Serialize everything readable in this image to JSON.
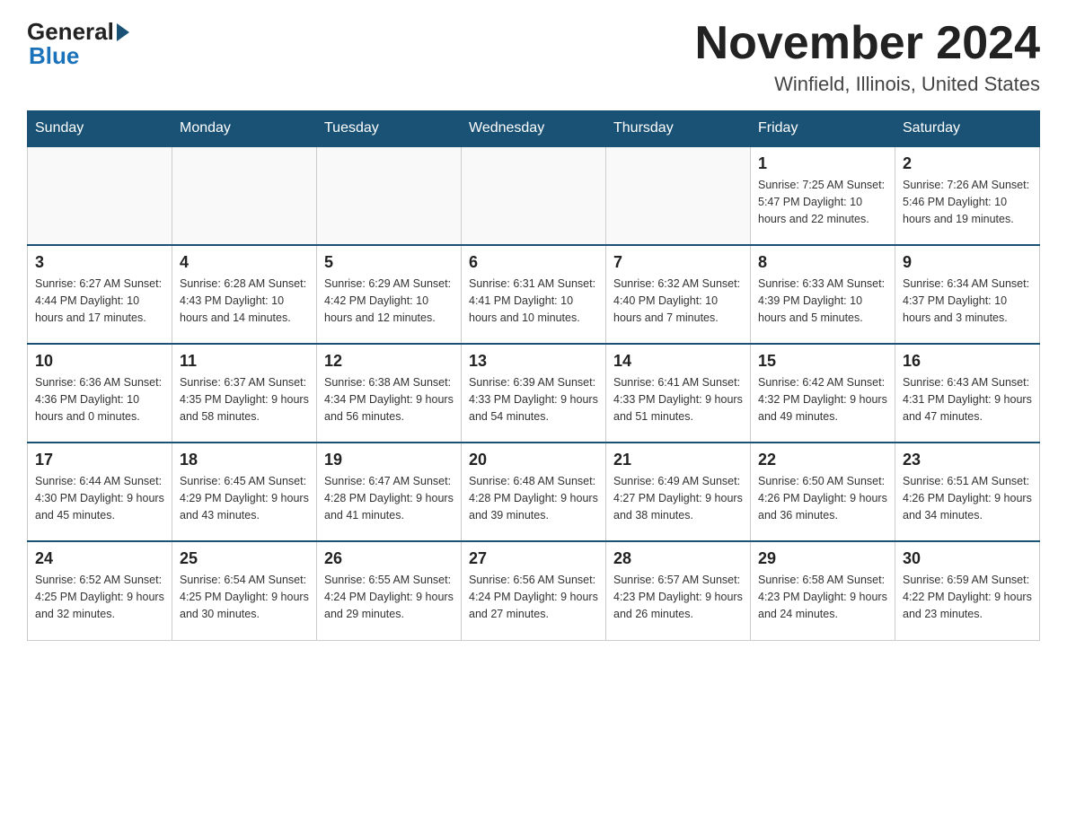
{
  "logo": {
    "general": "General",
    "blue": "Blue"
  },
  "title": "November 2024",
  "subtitle": "Winfield, Illinois, United States",
  "days_of_week": [
    "Sunday",
    "Monday",
    "Tuesday",
    "Wednesday",
    "Thursday",
    "Friday",
    "Saturday"
  ],
  "weeks": [
    [
      {
        "day": "",
        "info": ""
      },
      {
        "day": "",
        "info": ""
      },
      {
        "day": "",
        "info": ""
      },
      {
        "day": "",
        "info": ""
      },
      {
        "day": "",
        "info": ""
      },
      {
        "day": "1",
        "info": "Sunrise: 7:25 AM\nSunset: 5:47 PM\nDaylight: 10 hours and 22 minutes."
      },
      {
        "day": "2",
        "info": "Sunrise: 7:26 AM\nSunset: 5:46 PM\nDaylight: 10 hours and 19 minutes."
      }
    ],
    [
      {
        "day": "3",
        "info": "Sunrise: 6:27 AM\nSunset: 4:44 PM\nDaylight: 10 hours and 17 minutes."
      },
      {
        "day": "4",
        "info": "Sunrise: 6:28 AM\nSunset: 4:43 PM\nDaylight: 10 hours and 14 minutes."
      },
      {
        "day": "5",
        "info": "Sunrise: 6:29 AM\nSunset: 4:42 PM\nDaylight: 10 hours and 12 minutes."
      },
      {
        "day": "6",
        "info": "Sunrise: 6:31 AM\nSunset: 4:41 PM\nDaylight: 10 hours and 10 minutes."
      },
      {
        "day": "7",
        "info": "Sunrise: 6:32 AM\nSunset: 4:40 PM\nDaylight: 10 hours and 7 minutes."
      },
      {
        "day": "8",
        "info": "Sunrise: 6:33 AM\nSunset: 4:39 PM\nDaylight: 10 hours and 5 minutes."
      },
      {
        "day": "9",
        "info": "Sunrise: 6:34 AM\nSunset: 4:37 PM\nDaylight: 10 hours and 3 minutes."
      }
    ],
    [
      {
        "day": "10",
        "info": "Sunrise: 6:36 AM\nSunset: 4:36 PM\nDaylight: 10 hours and 0 minutes."
      },
      {
        "day": "11",
        "info": "Sunrise: 6:37 AM\nSunset: 4:35 PM\nDaylight: 9 hours and 58 minutes."
      },
      {
        "day": "12",
        "info": "Sunrise: 6:38 AM\nSunset: 4:34 PM\nDaylight: 9 hours and 56 minutes."
      },
      {
        "day": "13",
        "info": "Sunrise: 6:39 AM\nSunset: 4:33 PM\nDaylight: 9 hours and 54 minutes."
      },
      {
        "day": "14",
        "info": "Sunrise: 6:41 AM\nSunset: 4:33 PM\nDaylight: 9 hours and 51 minutes."
      },
      {
        "day": "15",
        "info": "Sunrise: 6:42 AM\nSunset: 4:32 PM\nDaylight: 9 hours and 49 minutes."
      },
      {
        "day": "16",
        "info": "Sunrise: 6:43 AM\nSunset: 4:31 PM\nDaylight: 9 hours and 47 minutes."
      }
    ],
    [
      {
        "day": "17",
        "info": "Sunrise: 6:44 AM\nSunset: 4:30 PM\nDaylight: 9 hours and 45 minutes."
      },
      {
        "day": "18",
        "info": "Sunrise: 6:45 AM\nSunset: 4:29 PM\nDaylight: 9 hours and 43 minutes."
      },
      {
        "day": "19",
        "info": "Sunrise: 6:47 AM\nSunset: 4:28 PM\nDaylight: 9 hours and 41 minutes."
      },
      {
        "day": "20",
        "info": "Sunrise: 6:48 AM\nSunset: 4:28 PM\nDaylight: 9 hours and 39 minutes."
      },
      {
        "day": "21",
        "info": "Sunrise: 6:49 AM\nSunset: 4:27 PM\nDaylight: 9 hours and 38 minutes."
      },
      {
        "day": "22",
        "info": "Sunrise: 6:50 AM\nSunset: 4:26 PM\nDaylight: 9 hours and 36 minutes."
      },
      {
        "day": "23",
        "info": "Sunrise: 6:51 AM\nSunset: 4:26 PM\nDaylight: 9 hours and 34 minutes."
      }
    ],
    [
      {
        "day": "24",
        "info": "Sunrise: 6:52 AM\nSunset: 4:25 PM\nDaylight: 9 hours and 32 minutes."
      },
      {
        "day": "25",
        "info": "Sunrise: 6:54 AM\nSunset: 4:25 PM\nDaylight: 9 hours and 30 minutes."
      },
      {
        "day": "26",
        "info": "Sunrise: 6:55 AM\nSunset: 4:24 PM\nDaylight: 9 hours and 29 minutes."
      },
      {
        "day": "27",
        "info": "Sunrise: 6:56 AM\nSunset: 4:24 PM\nDaylight: 9 hours and 27 minutes."
      },
      {
        "day": "28",
        "info": "Sunrise: 6:57 AM\nSunset: 4:23 PM\nDaylight: 9 hours and 26 minutes."
      },
      {
        "day": "29",
        "info": "Sunrise: 6:58 AM\nSunset: 4:23 PM\nDaylight: 9 hours and 24 minutes."
      },
      {
        "day": "30",
        "info": "Sunrise: 6:59 AM\nSunset: 4:22 PM\nDaylight: 9 hours and 23 minutes."
      }
    ]
  ]
}
